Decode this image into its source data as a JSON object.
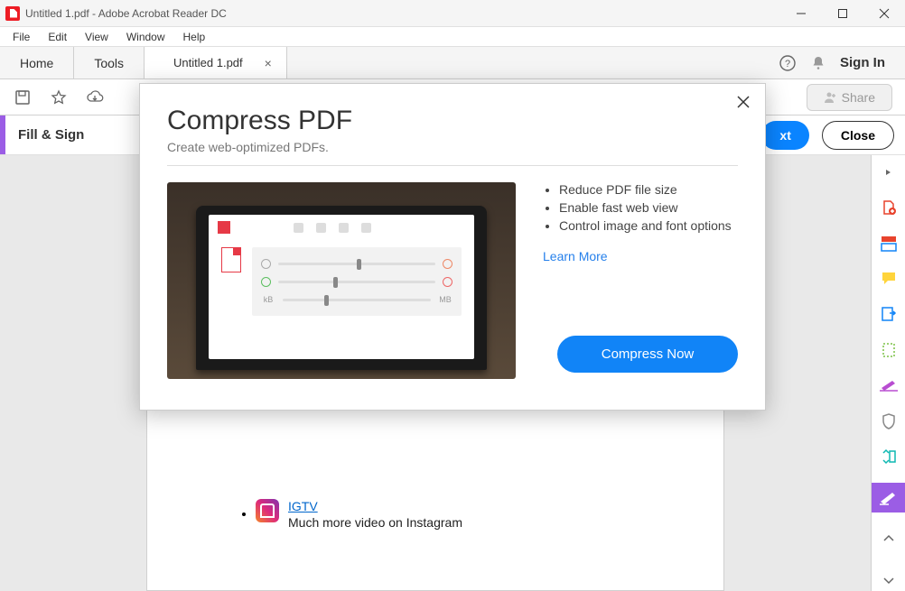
{
  "titlebar": {
    "title": "Untitled 1.pdf - Adobe Acrobat Reader DC"
  },
  "menubar": [
    "File",
    "Edit",
    "View",
    "Window",
    "Help"
  ],
  "tabs": {
    "home": "Home",
    "tools": "Tools",
    "doc": "Untitled 1.pdf",
    "signin": "Sign In"
  },
  "toolbar": {
    "share": "Share"
  },
  "subbar": {
    "label": "Fill & Sign",
    "next": "xt",
    "close": "Close"
  },
  "modal": {
    "title": "Compress PDF",
    "subtitle": "Create web-optimized PDFs.",
    "bullets": [
      "Reduce PDF file size",
      "Enable fast web view",
      "Control image and font options"
    ],
    "learn": "Learn More",
    "cta": "Compress Now",
    "slider_labels": {
      "kb": "kB",
      "mb": "MB"
    }
  },
  "doc": {
    "igtv_link": "IGTV",
    "igtv_sub": "Much more video on Instagram"
  }
}
